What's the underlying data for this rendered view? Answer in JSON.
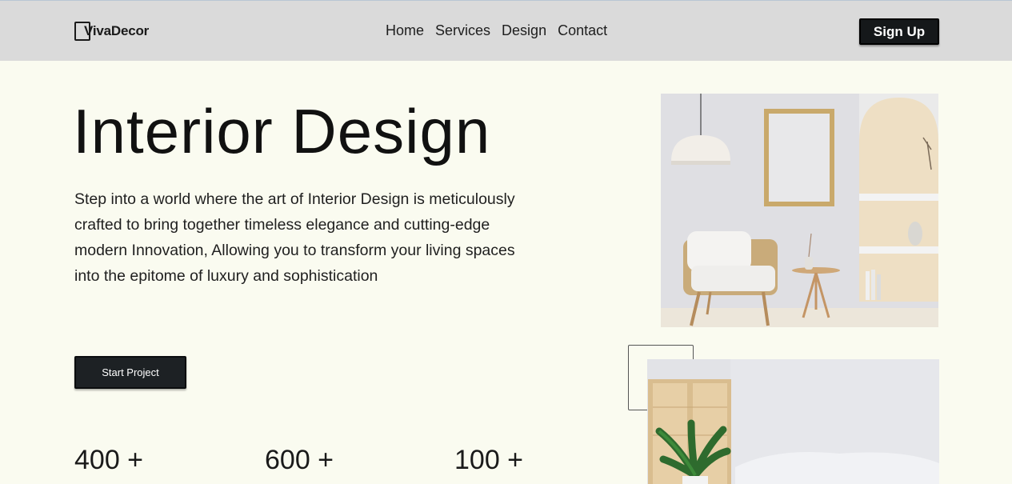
{
  "brand": {
    "name": "VivaDecor"
  },
  "nav": {
    "items": [
      "Home",
      "Services",
      "Design",
      "Contact"
    ]
  },
  "header": {
    "signup_label": "Sign Up"
  },
  "hero": {
    "title": "Interior Design",
    "description": "Step into a world where the art of Interior Design is meticulously crafted to bring together timeless elegance and cutting-edge modern Innovation, Allowing you to transform your living spaces into the epitome of luxury and sophistication",
    "cta_label": "Start Project"
  },
  "stats": [
    "400 +",
    "600 +",
    "100 +"
  ],
  "colors": {
    "background": "#fafbf0",
    "header": "#dadada",
    "button": "#1d2124"
  }
}
